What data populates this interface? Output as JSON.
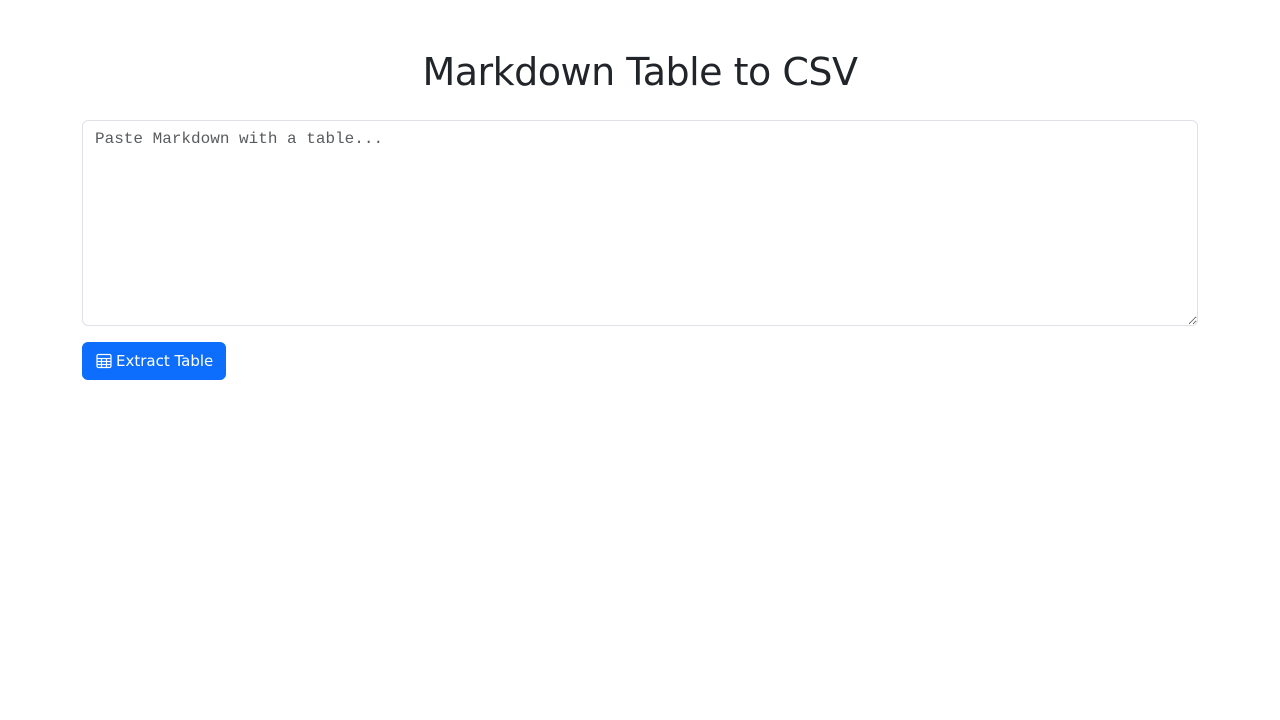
{
  "page": {
    "title": "Markdown Table to CSV"
  },
  "editor": {
    "value": "",
    "placeholder": "Paste Markdown with a table..."
  },
  "actions": {
    "extract_label": "Extract Table",
    "extract_icon": "table-icon"
  },
  "colors": {
    "primary": "#0d6efd",
    "text": "#212529",
    "border": "#dee2e6",
    "background": "#ffffff"
  }
}
